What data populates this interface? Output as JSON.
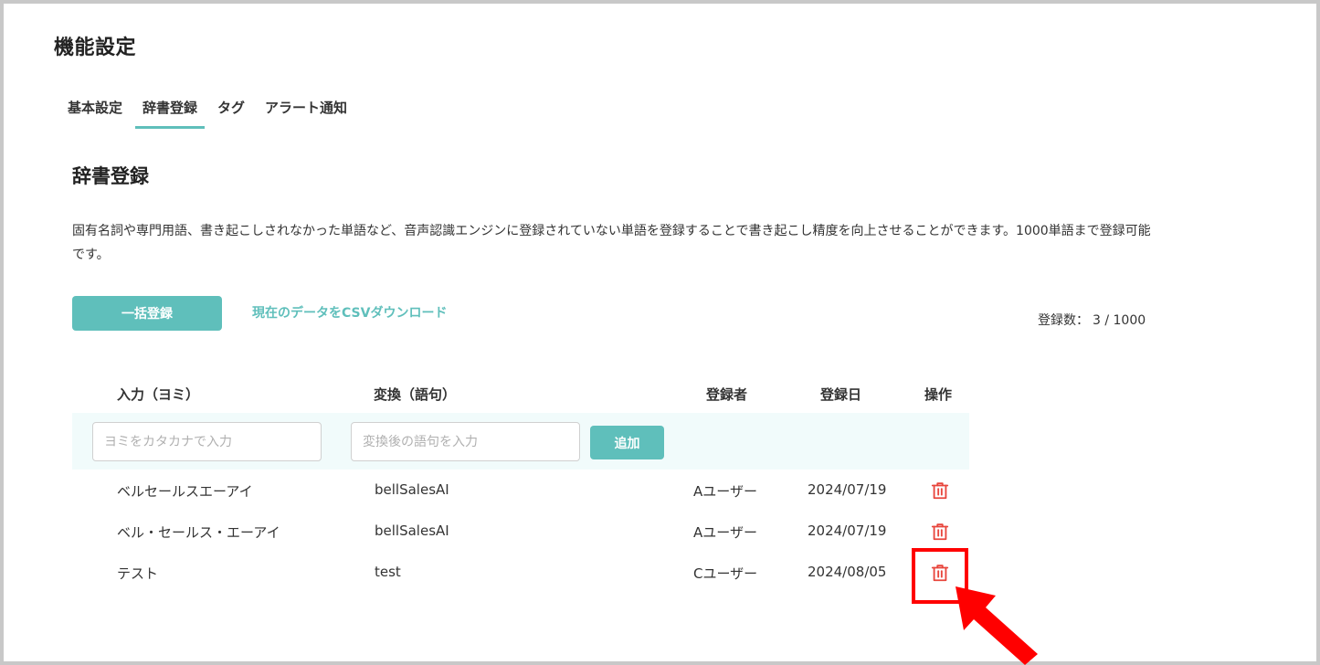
{
  "page": {
    "title": "機能設定"
  },
  "tabs": [
    {
      "label": "基本設定",
      "active": false
    },
    {
      "label": "辞書登録",
      "active": true
    },
    {
      "label": "タグ",
      "active": false
    },
    {
      "label": "アラート通知",
      "active": false
    }
  ],
  "section": {
    "title": "辞書登録",
    "description": "固有名詞や専門用語、書き起こしされなかった単語など、音声認識エンジンに登録されていない単語を登録することで書き起こし精度を向上させることができます。1000単語まで登録可能です。"
  },
  "actions": {
    "bulk_label": "一括登録",
    "csv_label": "現在のデータをCSVダウンロード"
  },
  "count": {
    "label": "登録数：",
    "value": "3 / 1000"
  },
  "table": {
    "headers": {
      "input": "入力（ヨミ）",
      "conversion": "変換（語句）",
      "registrant": "登録者",
      "date": "登録日",
      "operation": "操作"
    },
    "form": {
      "yomi_placeholder": "ヨミをカタカナで入力",
      "phrase_placeholder": "変換後の語句を入力",
      "add_label": "追加"
    },
    "rows": [
      {
        "yomi": "ベルセールスエーアイ",
        "phrase": "bellSalesAI",
        "user": "Aユーザー",
        "date": "2024/07/19"
      },
      {
        "yomi": "ベル・セールス・エーアイ",
        "phrase": "bellSalesAI",
        "user": "Aユーザー",
        "date": "2024/07/19"
      },
      {
        "yomi": "テスト",
        "phrase": "test",
        "user": "Cユーザー",
        "date": "2024/08/05"
      }
    ]
  },
  "icons": {
    "delete": "trash-icon",
    "annotation": "red-arrow-icon"
  },
  "colors": {
    "accent": "#5fbfbb",
    "delete": "#e8453c",
    "annotation": "#ff0000",
    "input_row_bg": "#f1fbfb"
  }
}
